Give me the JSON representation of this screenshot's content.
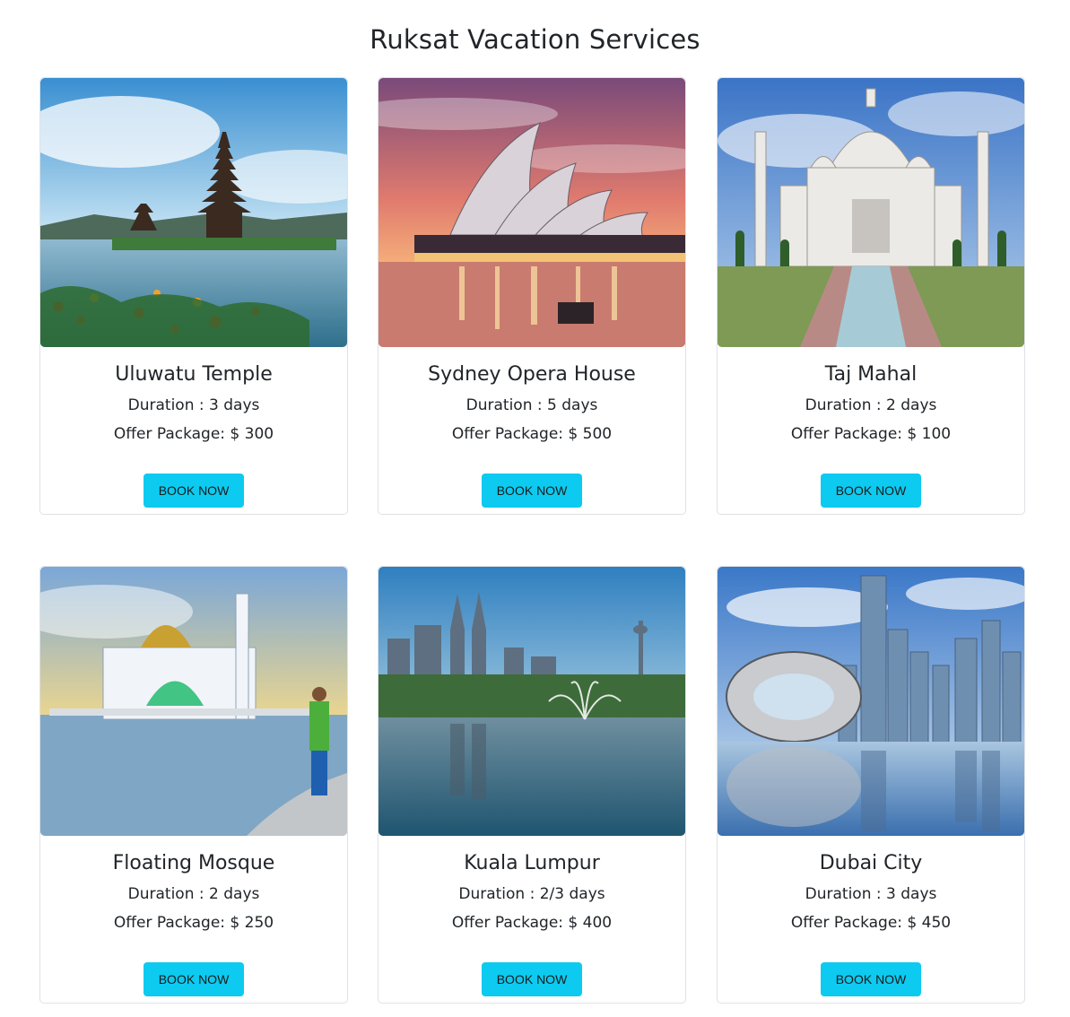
{
  "header": {
    "title": "Ruksat Vacation Services"
  },
  "colors": {
    "button": "#0dcaf0",
    "card_border": "#dfe2e6",
    "text": "#212529"
  },
  "cards": [
    {
      "name": "Uluwatu Temple",
      "duration": "Duration : 3 days",
      "offer": "Offer Package: $ 300",
      "button": "BOOK NOW",
      "image": "temple-on-lake-photo"
    },
    {
      "name": "Sydney Opera House",
      "duration": "Duration : 5 days",
      "offer": "Offer Package: $ 500",
      "button": "BOOK NOW",
      "image": "opera-house-sunset-photo"
    },
    {
      "name": "Taj Mahal",
      "duration": "Duration : 2 days",
      "offer": "Offer Package: $ 100",
      "button": "BOOK NOW",
      "image": "taj-mahal-photo"
    },
    {
      "name": "Floating Mosque",
      "duration": "Duration : 2 days",
      "offer": "Offer Package: $ 250",
      "button": "BOOK NOW",
      "image": "floating-mosque-photo"
    },
    {
      "name": "Kuala Lumpur",
      "duration": "Duration : 2/3 days",
      "offer": "Offer Package: $ 400",
      "button": "BOOK NOW",
      "image": "kuala-lumpur-skyline-photo"
    },
    {
      "name": "Dubai City",
      "duration": "Duration : 3 days",
      "offer": "Offer Package: $ 450",
      "button": "BOOK NOW",
      "image": "dubai-skyline-photo"
    }
  ]
}
